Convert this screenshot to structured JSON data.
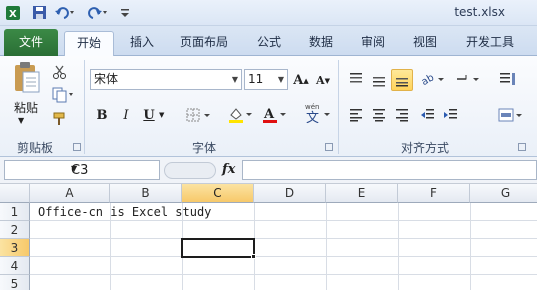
{
  "window": {
    "title": "test.xlsx"
  },
  "tabs": [
    "文件",
    "开始",
    "插入",
    "页面布局",
    "公式",
    "数据",
    "审阅",
    "视图",
    "开发工具"
  ],
  "ribbon": {
    "clipboard": {
      "paste_label": "粘贴",
      "group_label": "剪贴板"
    },
    "font": {
      "name": "宋体",
      "size": "11",
      "group_label": "字体",
      "bold": "B",
      "italic": "I",
      "underline": "U",
      "grow": "A",
      "shrink": "A",
      "font_color": "A",
      "phonetic": "文"
    },
    "alignment": {
      "group_label": "对齐方式"
    }
  },
  "formula_bar": {
    "name_box": "C3",
    "fx": "fx",
    "formula": ""
  },
  "sheet": {
    "columns": [
      "A",
      "B",
      "C",
      "D",
      "E",
      "F",
      "G"
    ],
    "rows": [
      "1",
      "2",
      "3",
      "4",
      "5"
    ],
    "active_cell": "C3",
    "cells": {
      "A1": "Office-cn is Excel study"
    }
  },
  "colors": {
    "file_tab": "#2f7a3b",
    "selection": "#ffd35a",
    "active_header": "#f7c96a"
  }
}
